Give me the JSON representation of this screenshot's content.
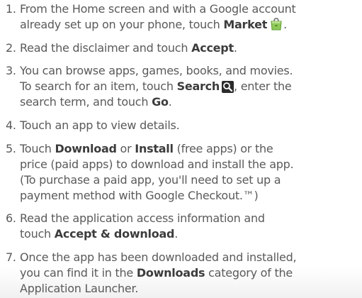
{
  "steps": [
    {
      "number": "1.",
      "line1_text": "From the Home screen and with a Google account",
      "line2_text": "already set up on your phone, touch ",
      "line2_bold": "Market",
      "line2_end": "."
    },
    {
      "number": "2.",
      "text": "Read the disclaimer and touch ",
      "bold": "Accept",
      "end": "."
    },
    {
      "number": "3.",
      "line1_text": "You can browse apps, games, books, and movies.",
      "line2_text": "To search for an item, touch ",
      "line2_bold": "Search",
      "line2_end": ", enter the",
      "line3_text": "search term, and touch ",
      "line3_bold": "Go",
      "line3_end": "."
    },
    {
      "number": "4.",
      "text": "Touch an app to view details."
    },
    {
      "number": "5.",
      "line1_text_a": "Touch ",
      "line1_bold_a": "Download",
      "line1_text_b": " or ",
      "line1_bold_b": "Install",
      "line1_text_c": " (free apps) or the",
      "line2_text": "price (paid apps) to download and install the app.",
      "line3_text": "(To purchase a paid app, you'll need to set up a",
      "line4_text": "payment method with Google Checkout.™)"
    },
    {
      "number": "6.",
      "line1_text": "Read the application access information and",
      "line2_text": "touch ",
      "line2_bold": "Accept & download",
      "line2_end": "."
    },
    {
      "number": "7.",
      "line1_text": "Once the app has been downloaded and installed,",
      "line2_text": "you can find it in the ",
      "line2_bold": "Downloads",
      "line2_end": " category of the",
      "line3_text": "Application Launcher."
    }
  ],
  "icons": {
    "market": "market-bag-icon",
    "search": "search-icon"
  },
  "colors": {
    "text": "#5a5a5a",
    "bold_text": "#3c3c3c",
    "market_green": "#7cb342",
    "search_bg": "#2b2b2b"
  }
}
